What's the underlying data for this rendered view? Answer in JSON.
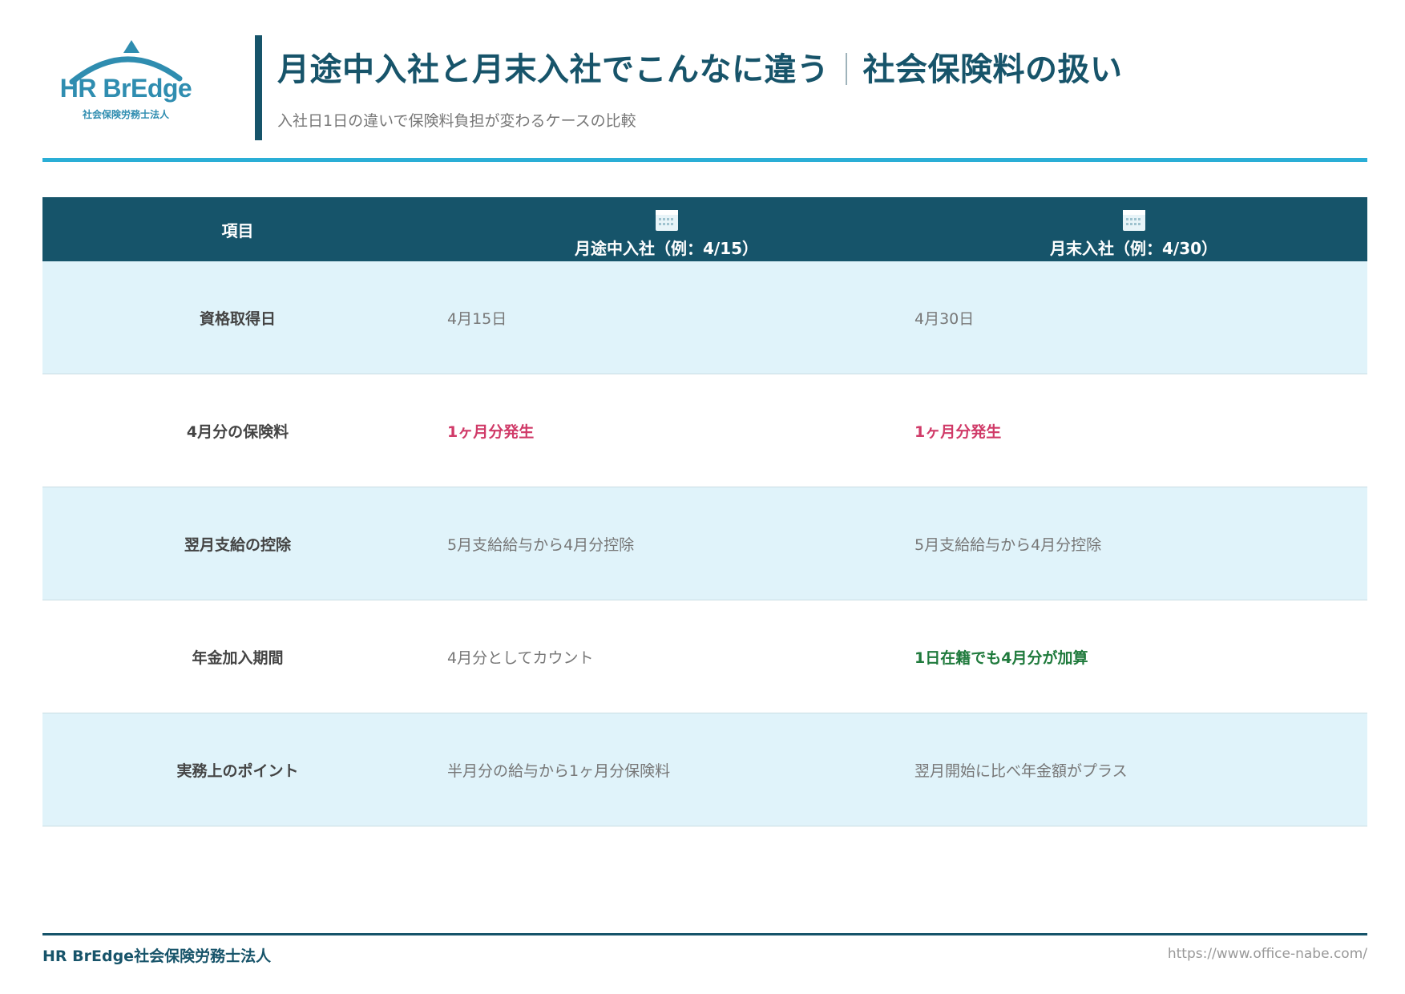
{
  "logo": {
    "name": "HR BrEdge",
    "subtitle": "社会保険労務士法人"
  },
  "header": {
    "title_main": "月途中入社と月末入社でこんなに違う",
    "title_sub": "社会保険料の扱い",
    "subtitle": "入社日1日の違いで保険料負担が変わるケースの比較"
  },
  "table": {
    "headers": {
      "item": "項目",
      "mid_month": "月途中入社（例：4/15）",
      "end_month": "月末入社（例：4/30）",
      "icon": "calendar-icon"
    },
    "rows": [
      {
        "item": "資格取得日",
        "mid_month": "4月15日",
        "end_month": "4月30日"
      },
      {
        "item": "4月分の保険料",
        "mid_month": "1ヶ月分発生",
        "end_month": "1ヶ月分発生"
      },
      {
        "item": "翌月支給の控除",
        "mid_month": "5月支給給与から4月分控除",
        "end_month": "5月支給給与から4月分控除"
      },
      {
        "item": "年金加入期間",
        "mid_month": "4月分としてカウント",
        "end_month": "1日在籍でも4月分が加算"
      },
      {
        "item": "実務上のポイント",
        "mid_month": "半月分の給与から1ヶ月分保険料",
        "end_month": "翌月開始に比べ年金額がプラス"
      }
    ]
  },
  "footer": {
    "company": "HR BrEdge社会保険労務士法人",
    "url": "https://www.office-nabe.com/"
  },
  "colors": {
    "primary": "#16546a",
    "accent": "#2aaed6",
    "alt_row": "#e0f3fa",
    "highlight_red": "#d03a68",
    "highlight_green": "#1f7a3c"
  }
}
